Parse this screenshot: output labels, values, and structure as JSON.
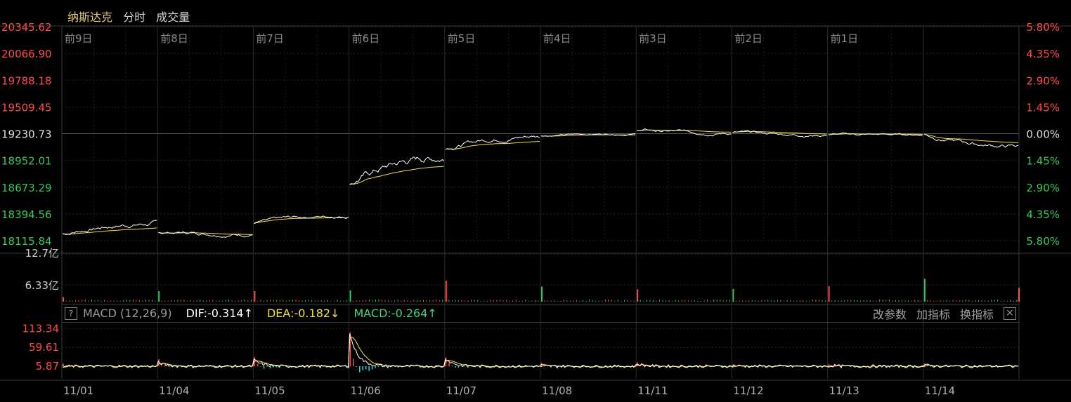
{
  "header": {
    "title": "纳斯达克",
    "tab_1": "分时",
    "tab_2": "成交量"
  },
  "colors": {
    "up": "#ff4b4b",
    "down": "#35c759",
    "price": "#ffffff",
    "avg": "#f5e23c",
    "grid": "#2a2a2a"
  },
  "chart_data": [
    {
      "type": "line",
      "y_labels_left": [
        "20345.62",
        "20066.90",
        "19788.18",
        "19509.45",
        "19230.73",
        "18952.01",
        "18673.29",
        "18394.56",
        "18115.84"
      ],
      "y_labels_right": [
        "5.80%",
        "4.35%",
        "2.90%",
        "1.45%",
        "0.00%",
        "1.45%",
        "2.90%",
        "4.35%",
        "5.80%"
      ],
      "top_labels": [
        "前9日",
        "前8日",
        "前7日",
        "前6日",
        "前5日",
        "前4日",
        "前3日",
        "前2日",
        "前1日"
      ],
      "ylim": [
        18115.84,
        20345.62
      ],
      "prev_close": 19230.73,
      "days": [
        {
          "open": 18185,
          "close": 18295,
          "min": 18150,
          "max": 18330
        },
        {
          "open": 18210,
          "close": 18190,
          "min": 18130,
          "max": 18260
        },
        {
          "open": 18300,
          "close": 18375,
          "min": 18280,
          "max": 18390
        },
        {
          "open": 18720,
          "close": 18980,
          "min": 18690,
          "max": 18990
        },
        {
          "open": 19080,
          "close": 19210,
          "min": 19060,
          "max": 19225
        },
        {
          "open": 19210,
          "close": 19230,
          "min": 19180,
          "max": 19245
        },
        {
          "open": 19270,
          "close": 19240,
          "min": 19180,
          "max": 19290
        },
        {
          "open": 19240,
          "close": 19220,
          "min": 19160,
          "max": 19270
        },
        {
          "open": 19220,
          "close": 19220,
          "min": 19180,
          "max": 19265
        },
        {
          "open": 19220,
          "close": 19100,
          "min": 19080,
          "max": 19230
        }
      ]
    },
    {
      "type": "bar",
      "y_labels": [
        "12.7亿",
        "6.33亿"
      ],
      "ylim": [
        0,
        12.7
      ],
      "spike_values": [
        1.2,
        2.8,
        2.8,
        3.0,
        5.6,
        4.0,
        3.3,
        3.4,
        4.1,
        6.1,
        3.7
      ]
    },
    {
      "type": "line",
      "indicator": "MACD (12,26,9)",
      "dif_label": "DIF:-0.314↑",
      "dea_label": "DEA:-0.182↓",
      "macd_label": "MACD:-0.264↑",
      "y_labels": [
        "113.34",
        "59.61",
        "5.87"
      ],
      "ylim": [
        -30,
        130
      ],
      "buttons": [
        "改参数",
        "加指标",
        "换指标"
      ],
      "x_labels": [
        "11/01",
        "11/04",
        "11/05",
        "11/06",
        "11/07",
        "11/08",
        "11/11",
        "11/12",
        "11/13",
        "11/14"
      ],
      "day_spikes": [
        0,
        12,
        20,
        105,
        25,
        3,
        8,
        3,
        3,
        4
      ]
    }
  ]
}
